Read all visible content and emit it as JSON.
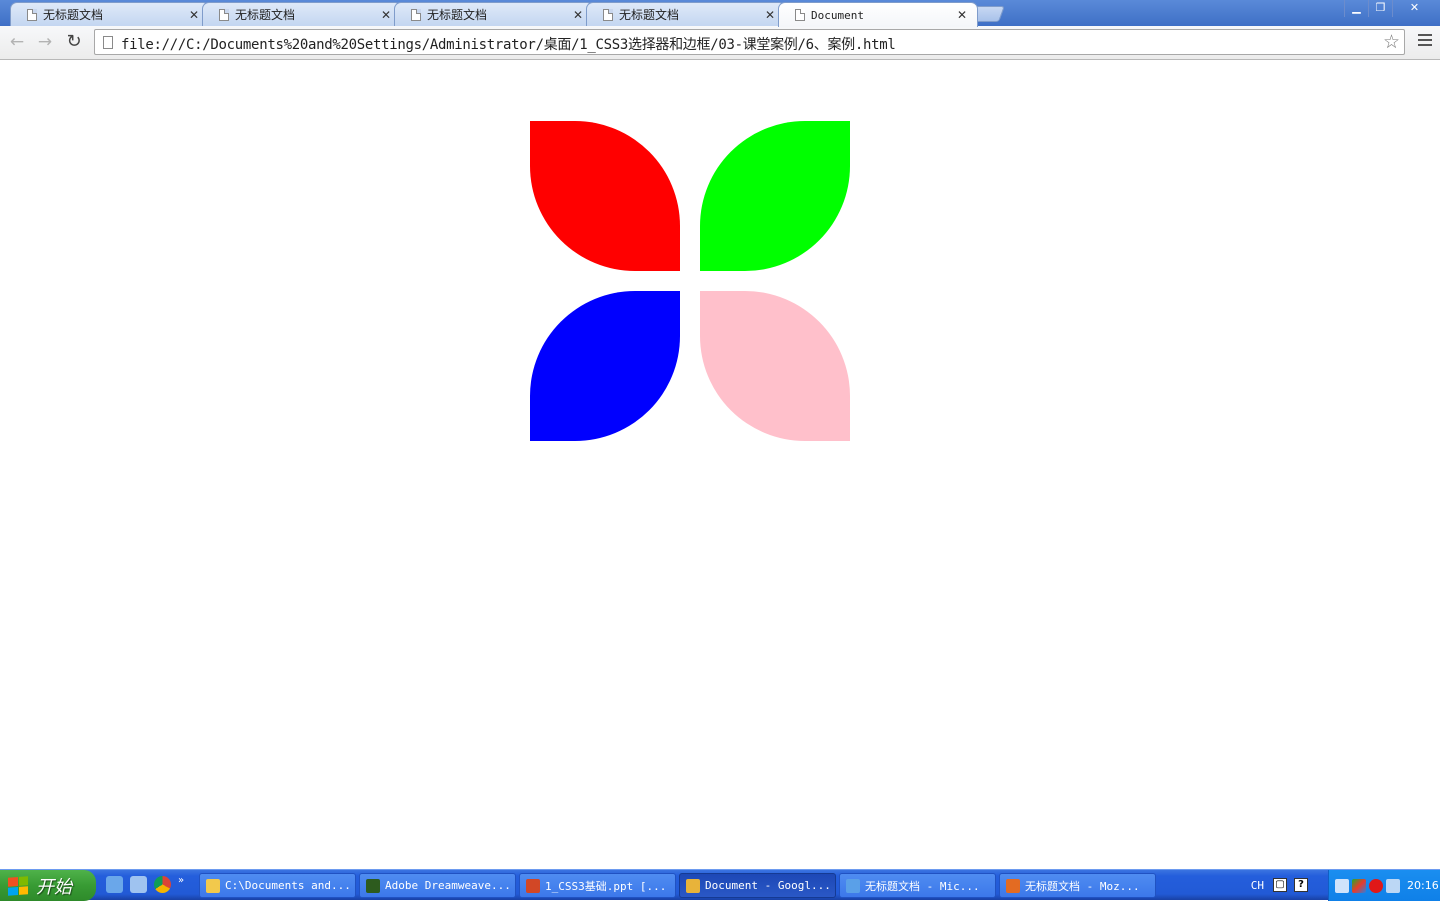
{
  "browser": {
    "tabs": [
      {
        "title": "无标题文档",
        "active": false
      },
      {
        "title": "无标题文档",
        "active": false
      },
      {
        "title": "无标题文档",
        "active": false
      },
      {
        "title": "无标题文档",
        "active": false
      },
      {
        "title": "Document",
        "active": true
      }
    ],
    "url": "file:///C:/Documents%20and%20Settings/Administrator/桌面/1_CSS3选择器和边框/03-课堂案例/6、案例.html"
  },
  "content": {
    "petals": [
      {
        "name": "red",
        "color": "#ff0000"
      },
      {
        "name": "green",
        "color": "#00ff00"
      },
      {
        "name": "blue",
        "color": "#0000ff"
      },
      {
        "name": "pink",
        "color": "#ffc0cb"
      }
    ]
  },
  "taskbar": {
    "start_label": "开始",
    "buttons": [
      {
        "label": "C:\\Documents and...",
        "icon": "folder-icon",
        "color": "#f2c94c"
      },
      {
        "label": "Adobe Dreamweave...",
        "icon": "dreamweaver-icon",
        "color": "#2d5b1e"
      },
      {
        "label": "1_CSS3基础.ppt [...",
        "icon": "powerpoint-icon",
        "color": "#d24726"
      },
      {
        "label": "Document - Googl...",
        "icon": "chrome-icon",
        "color": "#e8b33a"
      },
      {
        "label": "无标题文档 - Mic...",
        "icon": "ie-icon",
        "color": "#5aa0e8"
      },
      {
        "label": "无标题文档 - Moz...",
        "icon": "firefox-icon",
        "color": "#e36b22"
      }
    ],
    "lang": "CH",
    "clock": "20:16"
  }
}
